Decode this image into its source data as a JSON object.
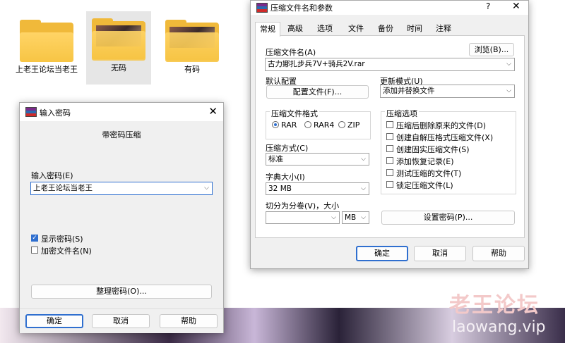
{
  "explorer": {
    "folders": [
      {
        "name": "上老王论坛当老王"
      },
      {
        "name": "无码"
      },
      {
        "name": "有码"
      }
    ]
  },
  "watermark": {
    "cn": "老王论坛",
    "url": "laowang.vip"
  },
  "password_dialog": {
    "title": "输入密码",
    "heading": "带密码压缩",
    "password_label": "输入密码(E)",
    "password_value": "上老王论坛当老王",
    "show_password_label": "显示密码(S)",
    "show_password_checked": true,
    "encrypt_names_label": "加密文件名(N)",
    "encrypt_names_checked": false,
    "organize_button": "整理密码(O)...",
    "ok": "确定",
    "cancel": "取消",
    "help": "帮助"
  },
  "archive_dialog": {
    "title": "压缩文件名和参数",
    "help_glyph": "?",
    "tabs": [
      "常规",
      "高级",
      "选项",
      "文件",
      "备份",
      "时间",
      "注释"
    ],
    "active_tab": "常规",
    "archive_name_label": "压缩文件名(A)",
    "browse_button": "浏览(B)...",
    "archive_name_value": "古力娜扎步兵7V+骑兵2V.rar",
    "default_config_label": "默认配置",
    "profiles_button": "配置文件(F)...",
    "update_mode_label": "更新模式(U)",
    "update_mode_value": "添加并替换文件",
    "format_label": "压缩文件格式",
    "formats": [
      "RAR",
      "RAR4",
      "ZIP"
    ],
    "format_selected": "RAR",
    "options_label": "压缩选项",
    "options": [
      {
        "label": "压缩后删除原来的文件(D)",
        "checked": false
      },
      {
        "label": "创建自解压格式压缩文件(X)",
        "checked": false
      },
      {
        "label": "创建固实压缩文件(S)",
        "checked": false
      },
      {
        "label": "添加恢复记录(E)",
        "checked": false
      },
      {
        "label": "测试压缩的文件(T)",
        "checked": false
      },
      {
        "label": "锁定压缩文件(L)",
        "checked": false
      }
    ],
    "method_label": "压缩方式(C)",
    "method_value": "标准",
    "dict_label": "字典大小(I)",
    "dict_value": "32 MB",
    "split_label": "切分为分卷(V)，大小",
    "split_value": "",
    "split_unit": "MB",
    "set_password_button": "设置密码(P)...",
    "ok": "确定",
    "cancel": "取消",
    "help": "帮助"
  }
}
